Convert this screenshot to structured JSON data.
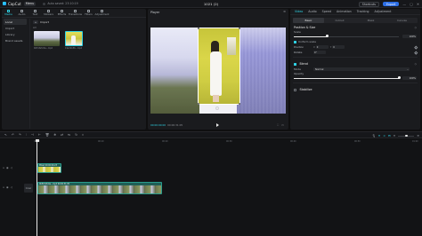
{
  "app": {
    "name": "CapCut",
    "menu_label": "Menu",
    "auto_save": "Auto saved: 23:10:19",
    "project_title": "1021 (2)",
    "shortcuts_label": "Shortcuts",
    "export_label": "Export",
    "window_controls": [
      "—",
      "▢",
      "✕"
    ]
  },
  "media_panel": {
    "tabs": [
      {
        "label": "Media",
        "icon": "media-icon",
        "active": true
      },
      {
        "label": "Audio",
        "icon": "audio-icon",
        "active": false
      },
      {
        "label": "Text",
        "icon": "text-icon",
        "active": false
      },
      {
        "label": "Stickers",
        "icon": "sticker-icon",
        "active": false
      },
      {
        "label": "Effects",
        "icon": "effects-icon",
        "active": false
      },
      {
        "label": "Transitions",
        "icon": "transitions-icon",
        "active": false
      },
      {
        "label": "Filters",
        "icon": "filters-icon",
        "active": false
      },
      {
        "label": "Adjustment",
        "icon": "adjustment-icon",
        "active": false
      }
    ],
    "sidebar": [
      {
        "label": "Local",
        "active": true
      },
      {
        "label": "Import",
        "active": false
      },
      {
        "label": "Library",
        "active": false
      },
      {
        "label": "Brand assets",
        "active": false
      }
    ],
    "import_label": "Import",
    "filter_label": "All",
    "thumbnails": [
      {
        "label": "0b51fa3c0a...mp4"
      },
      {
        "label": "19a31b56...mp4"
      }
    ]
  },
  "player": {
    "title": "Player",
    "current_time": "00:00:00:00",
    "total_time": "00:00:31:05"
  },
  "inspector": {
    "tabs": [
      {
        "label": "Video",
        "active": true
      },
      {
        "label": "Audio",
        "active": false
      },
      {
        "label": "Speed",
        "active": false
      },
      {
        "label": "Animation",
        "active": false
      },
      {
        "label": "Tracking",
        "active": false
      },
      {
        "label": "Adjustment",
        "active": false
      }
    ],
    "subtabs": [
      {
        "label": "Basic",
        "active": true
      },
      {
        "label": "Cutout",
        "active": false
      },
      {
        "label": "Mask",
        "active": false
      },
      {
        "label": "Canvas",
        "active": false
      }
    ],
    "position_size_title": "Position & Size",
    "scale_label": "Scale",
    "scale_value": "100%",
    "scale_fraction": 0.32,
    "uniform_scale_label": "Uniform scale",
    "position_label": "Position",
    "pos_x": "0",
    "pos_y": "0",
    "rotate_label": "Rotate",
    "rotate_value": "0°",
    "blend_title": "Blend",
    "mode_label": "Mode",
    "mode_value": "Normal",
    "opacity_label": "Opacity",
    "opacity_value": "100%",
    "opacity_fraction": 1.0,
    "stabilize_title": "Stabilize"
  },
  "timeline": {
    "ruler_labels": [
      "00:00",
      "00:10",
      "00:20",
      "00:30",
      "00:40",
      "00:50",
      "01:00"
    ],
    "clip1_label": "Mixer 00:00:04:23",
    "clip2_label": "0b51fa3c0a...mp4  00:00:31:05",
    "cover_label": "Cover"
  },
  "colors": {
    "accent": "#2fd3e5",
    "export": "#2d6fe6",
    "clip": "#1f5f57"
  }
}
